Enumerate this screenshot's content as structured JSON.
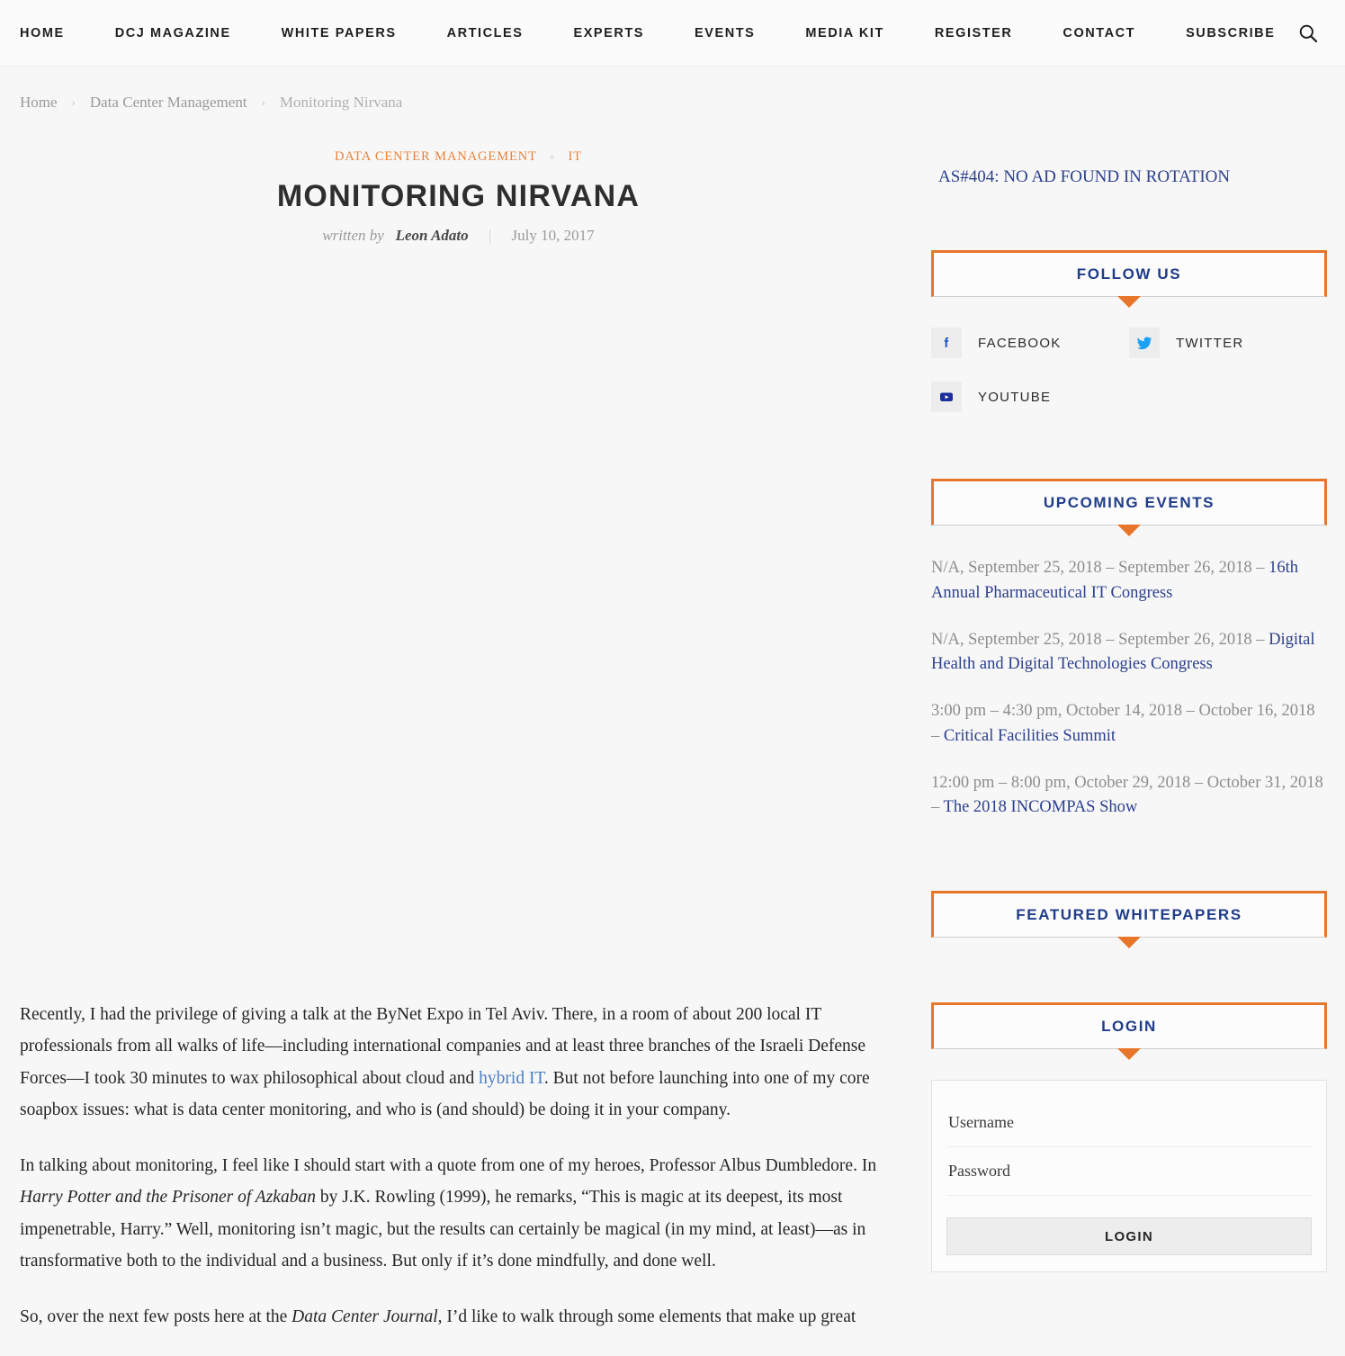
{
  "nav": {
    "items": [
      {
        "label": "HOME",
        "name": "nav-home"
      },
      {
        "label": "DCJ MAGAZINE",
        "name": "nav-dcj-magazine"
      },
      {
        "label": "WHITE PAPERS",
        "name": "nav-white-papers"
      },
      {
        "label": "ARTICLES",
        "name": "nav-articles"
      },
      {
        "label": "EXPERTS",
        "name": "nav-experts"
      },
      {
        "label": "EVENTS",
        "name": "nav-events"
      },
      {
        "label": "MEDIA KIT",
        "name": "nav-media-kit"
      },
      {
        "label": "REGISTER",
        "name": "nav-register"
      },
      {
        "label": "CONTACT",
        "name": "nav-contact"
      },
      {
        "label": "SUBSCRIBE",
        "name": "nav-subscribe"
      }
    ],
    "search_icon": "search-icon"
  },
  "breadcrumb": {
    "home": "Home",
    "section": "Data Center Management",
    "current": "Monitoring Nirvana",
    "separator": "›"
  },
  "article": {
    "categories": [
      "DATA CENTER MANAGEMENT",
      "IT"
    ],
    "category_separator": "⋄",
    "title": "MONITORING NIRVANA",
    "written_by_label": "written by",
    "author": "Leon Adato",
    "byline_divider": "|",
    "date": "July 10, 2017",
    "paragraphs": {
      "p1_a": "Recently, I had the privilege of giving a talk at the ByNet Expo in Tel Aviv. There, in a room of about 200 local IT professionals from all walks of life—including international companies and at least three branches of the Israeli Defense Forces—I took 30 minutes to wax philosophical about cloud and ",
      "p1_link": "hybrid IT",
      "p1_b": ". But not before launching into one of my core soapbox issues: what is data center monitoring, and who is (and should) be doing it in your company.",
      "p2_a": "In talking about monitoring, I feel like I should start with a quote from one of my heroes, Professor Albus Dumbledore. In ",
      "p2_title": "Harry Potter and the Prisoner of Azkaban",
      "p2_b": " by J.K. Rowling (1999), he remarks, “This is magic at its deepest, its most impenetrable, Harry.” Well, monitoring isn’t magic, but the results can certainly be magical (in my mind, at least)—as in transformative both to the individual and a business. But only if it’s done mindfully, and done well.",
      "p3_a": "So, over the next few posts here at the ",
      "p3_title": "Data Center Journal,",
      "p3_b": " I’d like to walk through some elements that make up great"
    }
  },
  "sidebar": {
    "ad_notice": "AS#404: NO AD FOUND IN ROTATION",
    "follow_us": {
      "title": "FOLLOW US",
      "links": [
        {
          "label": "FACEBOOK",
          "icon": "facebook-icon"
        },
        {
          "label": "TWITTER",
          "icon": "twitter-icon"
        },
        {
          "label": "YOUTUBE",
          "icon": "youtube-icon"
        }
      ]
    },
    "upcoming_events": {
      "title": "UPCOMING EVENTS",
      "items": [
        {
          "meta": "N/A, September 25, 2018 – September 26, 2018 – ",
          "link": "16th Annual Pharmaceutical IT Congress"
        },
        {
          "meta": "N/A, September 25, 2018 – September 26, 2018 – ",
          "link": "Digital Health and Digital Technologies Congress"
        },
        {
          "meta": "3:00 pm – 4:30 pm, October 14, 2018 – October 16, 2018 – ",
          "link": "Critical Facilities Summit"
        },
        {
          "meta": "12:00 pm – 8:00 pm, October 29, 2018 – October 31, 2018 – ",
          "link": "The 2018 INCOMPAS Show"
        }
      ]
    },
    "featured_whitepapers": {
      "title": "FEATURED WHITEPAPERS"
    },
    "login": {
      "title": "LOGIN",
      "username_placeholder": "Username",
      "password_placeholder": "Password",
      "submit_label": "LOGIN"
    }
  },
  "colors": {
    "accent_orange": "#e8762a",
    "heading_blue": "#1f3c88",
    "link_blue": "#2b3f8c",
    "category_orange": "#e8833a",
    "body_text": "#262626",
    "page_bg": "#f7f7f7"
  }
}
